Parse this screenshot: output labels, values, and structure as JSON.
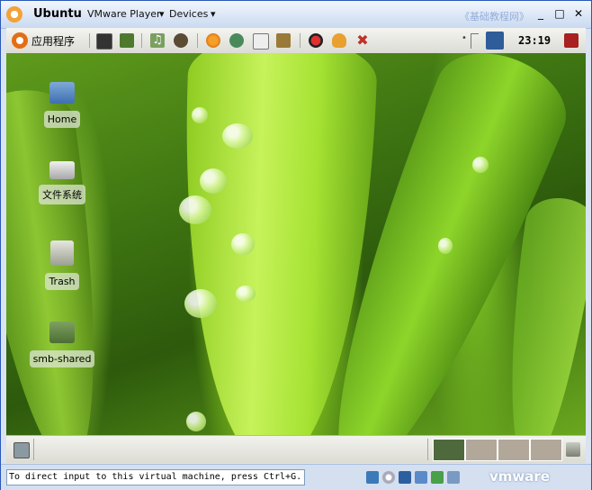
{
  "window": {
    "title": "Ubuntu",
    "menus": [
      {
        "label": "VMware Player"
      },
      {
        "label": "Devices"
      }
    ],
    "watermark": "《基础教程网》",
    "controls": {
      "minimize": "_",
      "maximize": "□",
      "close": "✕"
    }
  },
  "top_panel": {
    "apps_menu": "应用程序",
    "launchers": [
      "terminal-icon",
      "folder-icon",
      "music-icon",
      "sound-juicer-icon",
      "firefox-icon",
      "network-icon",
      "text-editor-icon",
      "archive-icon",
      "media-icon",
      "game-icon",
      "close-app-icon"
    ],
    "clock": "23:19"
  },
  "desktop": {
    "icons": [
      {
        "label": "Home",
        "icon": "home-folder-icon"
      },
      {
        "label": "文件系统",
        "icon": "harddisk-icon"
      },
      {
        "label": "Trash",
        "icon": "trash-icon"
      },
      {
        "label": "smb-shared",
        "icon": "folder-icon"
      }
    ]
  },
  "bottom_panel": {
    "workspaces": 4,
    "active_workspace": 1
  },
  "status_bar": {
    "text": "To direct input to this virtual machine, press Ctrl+G.",
    "logo": "vmware"
  },
  "colors": {
    "titlebar_border": "#2a57b8",
    "watermark": "#93aedb",
    "workspace": "#b1a89a",
    "active_workspace": "#4e6a3c"
  }
}
